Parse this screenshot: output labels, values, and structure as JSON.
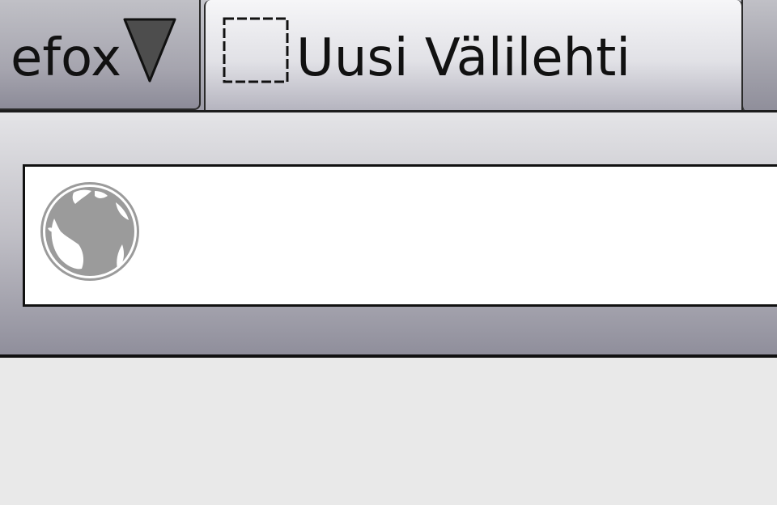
{
  "app": {
    "menu_button_label": "efox",
    "menu_button_icon": "dropdown-triangle-icon"
  },
  "tabs": [
    {
      "title": "Uusi Välilehti",
      "icon": "blank-page-icon",
      "selected": true
    }
  ],
  "urlbar": {
    "value": "",
    "placeholder": "",
    "identity_icon": "globe-icon"
  },
  "colors": {
    "toolbar_top": "#e4e4e7",
    "toolbar_bottom": "#8f8e9b",
    "content_background": "#e9e9e9",
    "globe_icon": "#9b9b9b",
    "dropdown_triangle": "#4d4d4d"
  }
}
